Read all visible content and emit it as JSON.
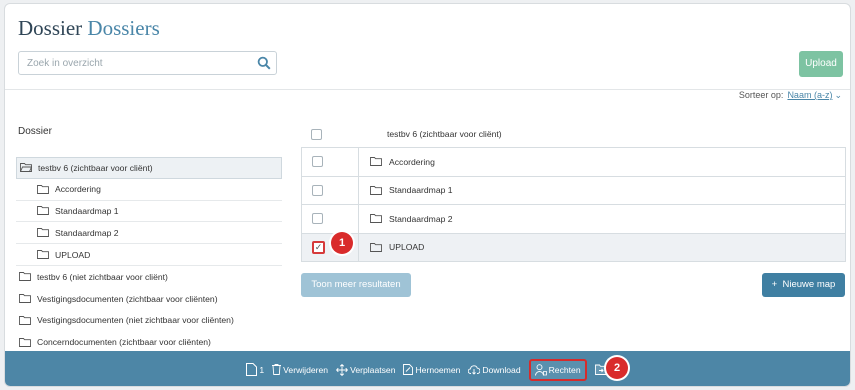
{
  "header": {
    "title_main": "Dossier",
    "title_accent": "Dossiers",
    "search_placeholder": "Zoek in overzicht",
    "upload_label": "Upload"
  },
  "sort": {
    "label": "Sorteer op:",
    "value": "Naam (a-z)"
  },
  "tree": {
    "heading": "Dossier",
    "items": [
      {
        "label": "testbv 6 (zichtbaar voor cliënt)",
        "selected": true,
        "open": true
      },
      {
        "label": "Accordering",
        "child": true
      },
      {
        "label": "Standaardmap 1",
        "child": true
      },
      {
        "label": "Standaardmap 2",
        "child": true
      },
      {
        "label": "UPLOAD",
        "child": true
      }
    ],
    "bottom_items": [
      {
        "label": "testbv 6 (niet zichtbaar voor cliënt)"
      },
      {
        "label": "Vestigingsdocumenten (zichtbaar voor cliënten)"
      },
      {
        "label": "Vestigingsdocumenten (niet zichtbaar voor cliënten)"
      },
      {
        "label": "Concerndocumenten (zichtbaar voor cliënten)"
      }
    ]
  },
  "list": {
    "header": "testbv 6 (zichtbaar voor cliënt)",
    "rows": [
      {
        "label": "Accordering",
        "checked": false
      },
      {
        "label": "Standaardmap 1",
        "checked": false
      },
      {
        "label": "Standaardmap 2",
        "checked": false
      },
      {
        "label": "UPLOAD",
        "checked": true
      }
    ]
  },
  "buttons": {
    "meer": "Toon meer resultaten",
    "nieuw": "Nieuwe map",
    "nieuw_prefix": "+"
  },
  "badges": {
    "one": "1",
    "two": "2"
  },
  "toolbar": {
    "count": "1",
    "verwijderen": "Verwijderen",
    "verplaatsen": "Verplaatsen",
    "hernoemen": "Hernoemen",
    "download": "Download",
    "rechten": "Rechten"
  },
  "colors": {
    "accent": "#4a86a8",
    "toolbar": "#4d86a6",
    "upload": "#7dc3a2",
    "highlight": "#d62b2b"
  }
}
